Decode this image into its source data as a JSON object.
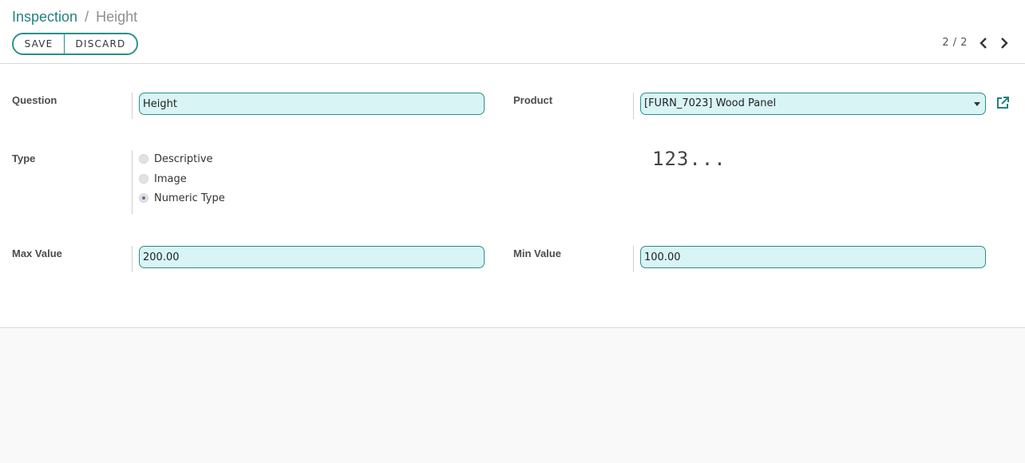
{
  "breadcrumb": {
    "parent": "Inspection",
    "separator": "/",
    "current": "Height"
  },
  "toolbar": {
    "save_label": "SAVE",
    "discard_label": "DISCARD"
  },
  "pager": {
    "value": "2 / 2"
  },
  "form": {
    "question": {
      "label": "Question",
      "value": "Height"
    },
    "product": {
      "label": "Product",
      "value": "[FURN_7023] Wood Panel"
    },
    "type": {
      "label": "Type",
      "options": [
        "Descriptive",
        "Image",
        "Numeric Type"
      ],
      "selected": "Numeric Type"
    },
    "numeric_preview": "123...",
    "max_value": {
      "label": "Max Value",
      "value": "200.00"
    },
    "min_value": {
      "label": "Min Value",
      "value": "100.00"
    }
  },
  "colors": {
    "accent": "#21837d",
    "input_bg": "#d8f4f5",
    "radio_dot": "#5b6fa7"
  }
}
